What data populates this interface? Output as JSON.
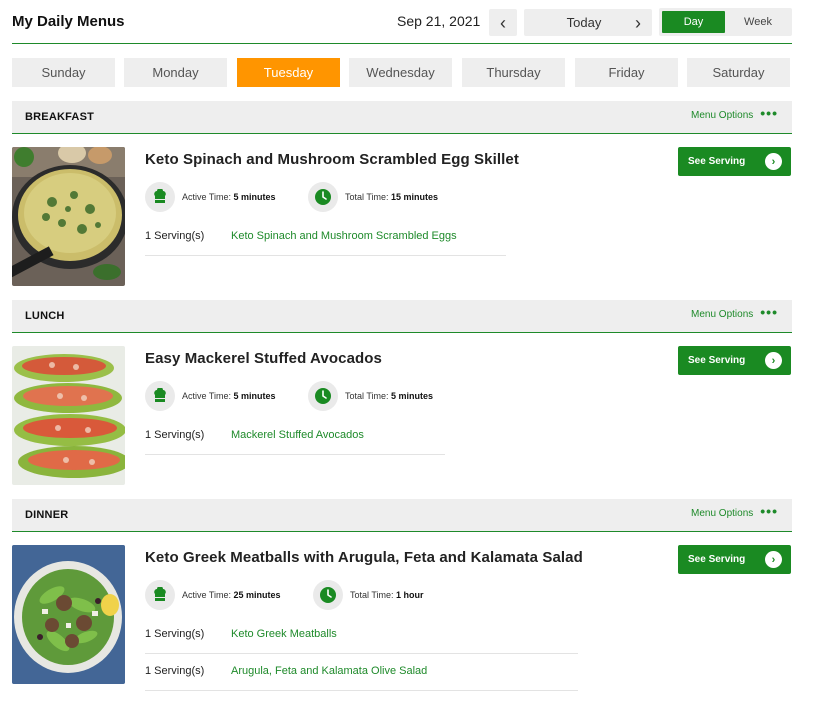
{
  "header": {
    "title": "My Daily Menus",
    "date": "Sep 21, 2021",
    "prev_icon": "chevron-left-icon",
    "prev_glyph": "‹",
    "today_label": "Today",
    "next_icon": "chevron-right-icon",
    "next_glyph": "›",
    "views": [
      "Day",
      "Week"
    ],
    "active_view": "Day"
  },
  "days": [
    {
      "label": "Sunday",
      "active": false
    },
    {
      "label": "Monday",
      "active": false
    },
    {
      "label": "Tuesday",
      "active": true
    },
    {
      "label": "Wednesday",
      "active": false
    },
    {
      "label": "Thursday",
      "active": false
    },
    {
      "label": "Friday",
      "active": false
    },
    {
      "label": "Saturday",
      "active": false
    }
  ],
  "colors": {
    "accent_green": "#1a8a22",
    "active_day_orange": "#ff9500",
    "tab_gray": "#eeeeee"
  },
  "menu_options_label": "Menu Options",
  "menu_options_dots": "•••",
  "see_serving_label": "See Serving",
  "see_serving_glyph": "›",
  "active_time_label": "Active Time:",
  "total_time_label": "Total Time:",
  "meals": [
    {
      "name": "BREAKFAST",
      "recipe": {
        "title": "Keto Spinach and Mushroom Scrambled Egg Skillet",
        "active_time": "5 minutes",
        "total_time": "15 minutes",
        "image_icon": "egg-skillet-photo",
        "servings": [
          {
            "qty": "1 Serving(s)",
            "name": "Keto Spinach and Mushroom Scrambled Eggs"
          }
        ]
      }
    },
    {
      "name": "LUNCH",
      "recipe": {
        "title": "Easy Mackerel Stuffed Avocados",
        "active_time": "5 minutes",
        "total_time": "5 minutes",
        "image_icon": "stuffed-avocado-photo",
        "servings": [
          {
            "qty": "1 Serving(s)",
            "name": "Mackerel Stuffed Avocados"
          }
        ]
      }
    },
    {
      "name": "DINNER",
      "recipe": {
        "title": "Keto Greek Meatballs with Arugula, Feta and Kalamata Salad",
        "active_time": "25 minutes",
        "total_time": "1 hour",
        "image_icon": "meatball-salad-photo",
        "servings": [
          {
            "qty": "1 Serving(s)",
            "name": "Keto Greek Meatballs"
          },
          {
            "qty": "1 Serving(s)",
            "name": "Arugula, Feta and Kalamata Olive Salad"
          }
        ]
      }
    }
  ]
}
